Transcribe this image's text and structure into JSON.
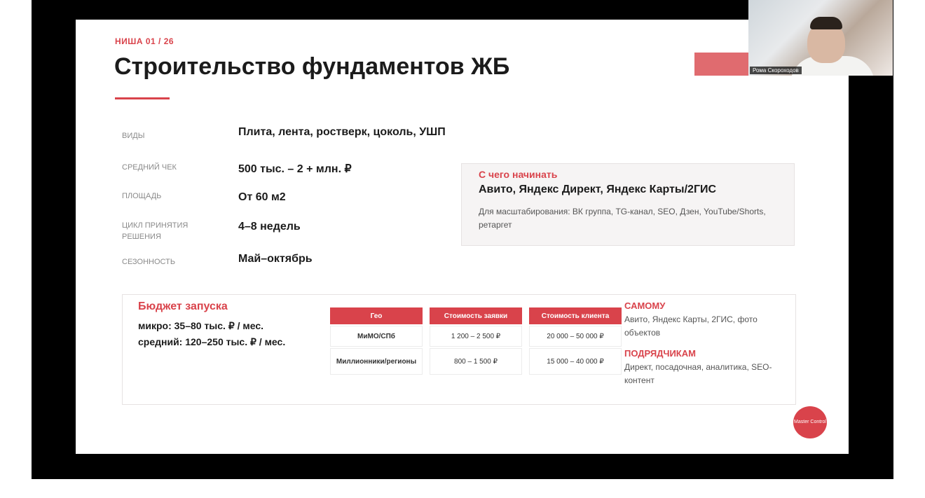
{
  "slide": {
    "kicker": "НИША 01 / 26",
    "title": "Строительство фундаментов ЖБ",
    "rows": [
      {
        "label": "ВИДЫ",
        "value": "Плита, лента, ростверк, цоколь, УШП"
      },
      {
        "label": "СРЕДНИЙ ЧЕК",
        "value": "500 тыс. – 2 + млн. ₽"
      },
      {
        "label": "ПЛОЩАДЬ",
        "value": "От 60 м2"
      },
      {
        "label": "ЦИКЛ ПРИНЯТИЯ РЕШЕНИЯ",
        "value": "4–8 недель"
      },
      {
        "label": "СЕЗОННОСТЬ",
        "value": "Май–октябрь"
      }
    ],
    "start": {
      "title": "С чего начинать",
      "main": "Авито, Яндекс Директ, Яндекс Карты/2ГИС",
      "note": "Для масштабирования: ВК группа, TG-канал, SEO, Дзен, YouTube/Shorts, ретаргет"
    },
    "budget": {
      "title": "Бюджет запуска",
      "micro": "микро: 35–80 тыс. ₽ / мес.",
      "medium": "средний: 120–250 тыс. ₽ / мес."
    },
    "table": {
      "headers": [
        "Гео",
        "Стоимость заявки",
        "Стоимость клиента"
      ],
      "rows": [
        [
          "МиМО/СПб",
          "1 200 – 2 500 ₽",
          "20 000 – 50 000 ₽"
        ],
        [
          "Миллионники/регионы",
          "800 – 1 500 ₽",
          "15 000 – 40 000 ₽"
        ]
      ]
    },
    "self": {
      "title": "САМОМУ",
      "text": "Авито, Яндекс Карты, 2ГИС, фото объектов"
    },
    "contractors": {
      "title": "ПОДРЯДЧИКАМ",
      "text": "Директ, посадочная, аналитика, SEO-контент"
    },
    "logo_text": "Master Control"
  },
  "webcam": {
    "name": "Рома Скороходов"
  },
  "colors": {
    "accent": "#d9434b",
    "text": "#1b1b1b"
  }
}
